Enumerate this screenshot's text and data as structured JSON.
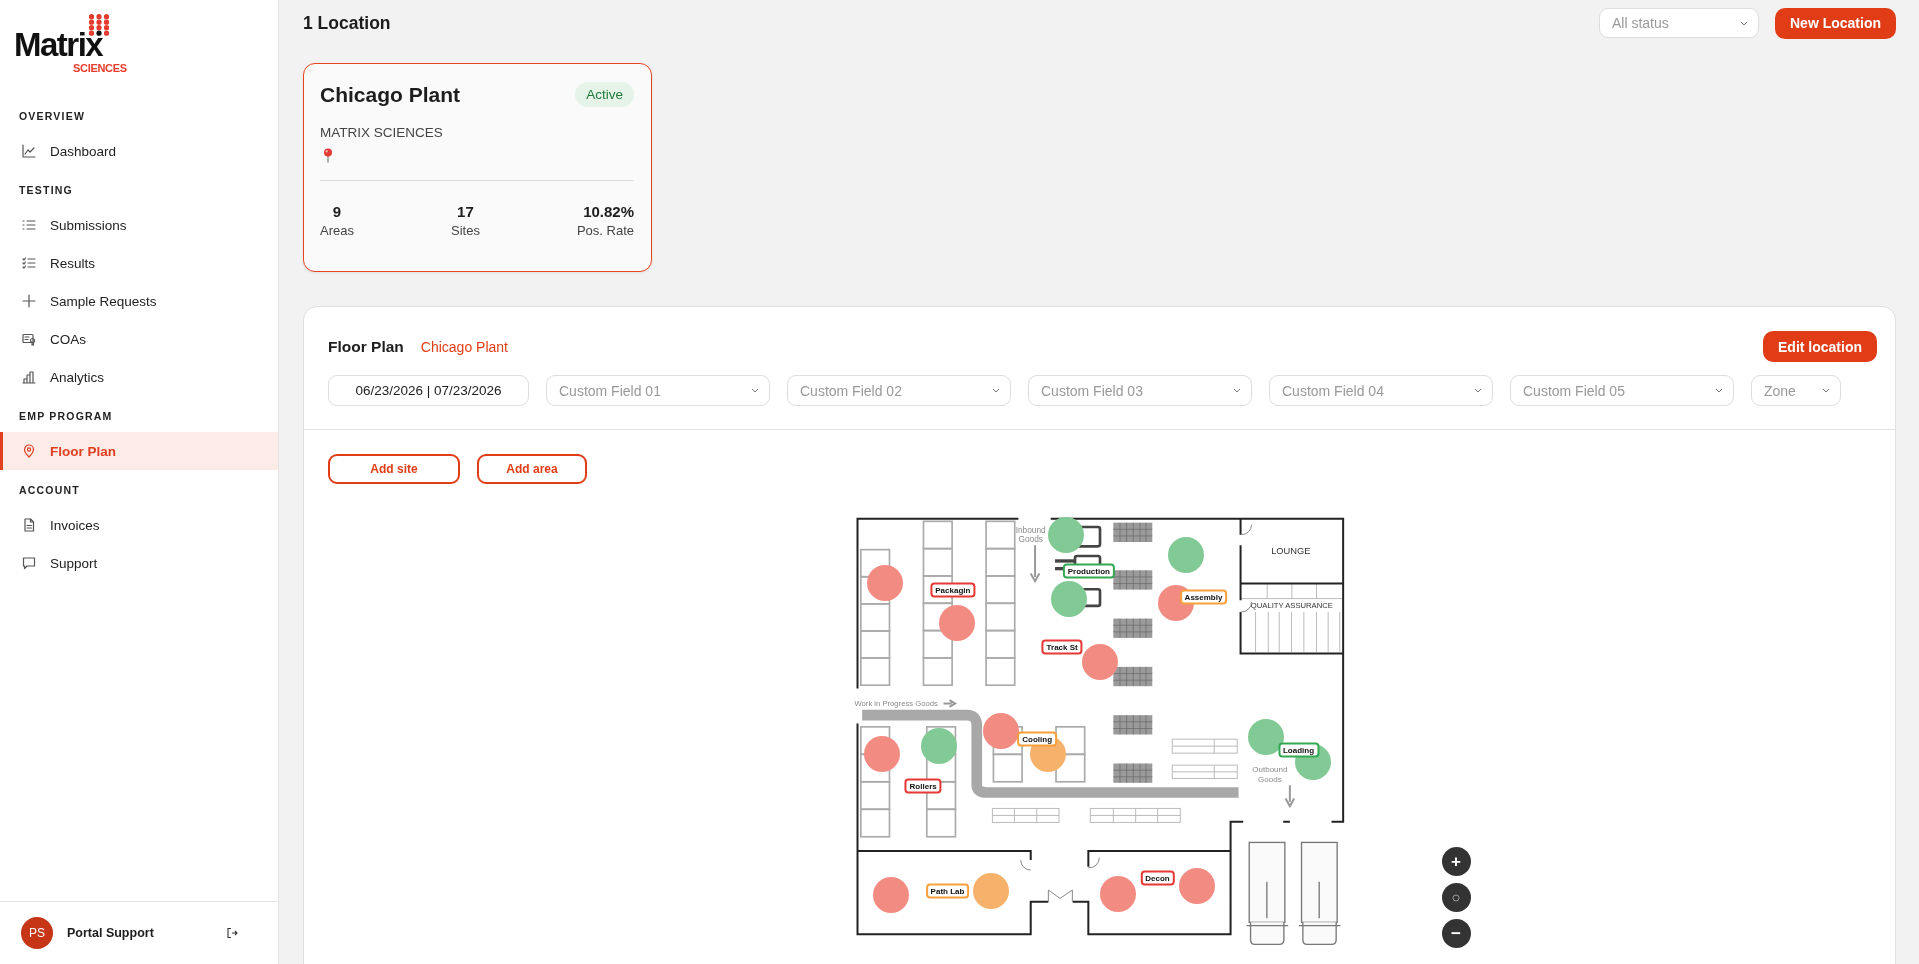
{
  "sidebar": {
    "logo": {
      "name": "Matrix",
      "tagline": "SCIENCES"
    },
    "sections": [
      {
        "title": "OVERVIEW",
        "items": [
          {
            "label": "Dashboard",
            "selected": false
          }
        ]
      },
      {
        "title": "TESTING",
        "items": [
          {
            "label": "Submissions",
            "selected": false
          },
          {
            "label": "Results",
            "selected": false
          },
          {
            "label": "Sample Requests",
            "selected": false
          },
          {
            "label": "COAs",
            "selected": false
          },
          {
            "label": "Analytics",
            "selected": false
          }
        ]
      },
      {
        "title": "EMP PROGRAM",
        "items": [
          {
            "label": "Floor Plan",
            "selected": true
          }
        ]
      },
      {
        "title": "ACCOUNT",
        "items": [
          {
            "label": "Invoices",
            "selected": false
          },
          {
            "label": "Support",
            "selected": false
          }
        ]
      }
    ],
    "user": {
      "initials": "PS",
      "name": "Portal Support"
    }
  },
  "header": {
    "title": "1 Location",
    "status_filter": {
      "placeholder": "All status"
    },
    "new_button": "New Location"
  },
  "locations": [
    {
      "name": "Chicago Plant",
      "status": "Active",
      "company": "MATRIX SCIENCES",
      "selected": true,
      "stats": [
        {
          "value": "9",
          "label": "Areas"
        },
        {
          "value": "17",
          "label": "Sites"
        },
        {
          "value": "10.82%",
          "label": "Pos. Rate"
        }
      ]
    }
  ],
  "floor_plan": {
    "title": "Floor Plan",
    "location": "Chicago Plant",
    "edit_button": "Edit location",
    "date_range": "06/23/2026 | 07/23/2026",
    "filters": [
      {
        "placeholder": "Custom Field 01"
      },
      {
        "placeholder": "Custom Field 02"
      },
      {
        "placeholder": "Custom Field 03"
      },
      {
        "placeholder": "Custom Field 04"
      },
      {
        "placeholder": "Custom Field 05"
      },
      {
        "placeholder": "Zone"
      }
    ],
    "actions": [
      "Add site",
      "Add area"
    ],
    "room_labels": [
      "Inbound Goods",
      "LOUNGE",
      "QUALITY ASSURANCE",
      "Work in Progress Goods",
      "Outbound Goods"
    ],
    "sites": [
      {
        "color": "#81c995"
      },
      {
        "color": "#81c995"
      },
      {
        "color": "#81c995"
      },
      {
        "color": "#f28b82"
      },
      {
        "color": "#f28b82"
      },
      {
        "color": "#f28b82"
      },
      {
        "color": "#f28b82"
      },
      {
        "color": "#f28b82"
      },
      {
        "color": "#f28b82"
      },
      {
        "color": "#81c995"
      },
      {
        "color": "#f6b26b"
      },
      {
        "color": "#81c995"
      },
      {
        "color": "#81c995"
      },
      {
        "color": "#f28b82"
      },
      {
        "color": "#f6b26b"
      },
      {
        "color": "#f28b82"
      },
      {
        "color": "#f28b82"
      }
    ],
    "areas": [
      {
        "label": "Packagin",
        "color": "#e53935"
      },
      {
        "label": "Production",
        "color": "#34a853"
      },
      {
        "label": "Assembly",
        "color": "#f6a03c"
      },
      {
        "label": "Track St",
        "color": "#e53935"
      },
      {
        "label": "Cooling",
        "color": "#f6a03c"
      },
      {
        "label": "Rollers",
        "color": "#e53935"
      },
      {
        "label": "Loading",
        "color": "#34a853"
      },
      {
        "label": "Path Lab",
        "color": "#f6a03c"
      },
      {
        "label": "Decon",
        "color": "#e53935"
      }
    ],
    "zoom_controls": {
      "zoom_in": "+",
      "zoom_out": "−"
    }
  }
}
